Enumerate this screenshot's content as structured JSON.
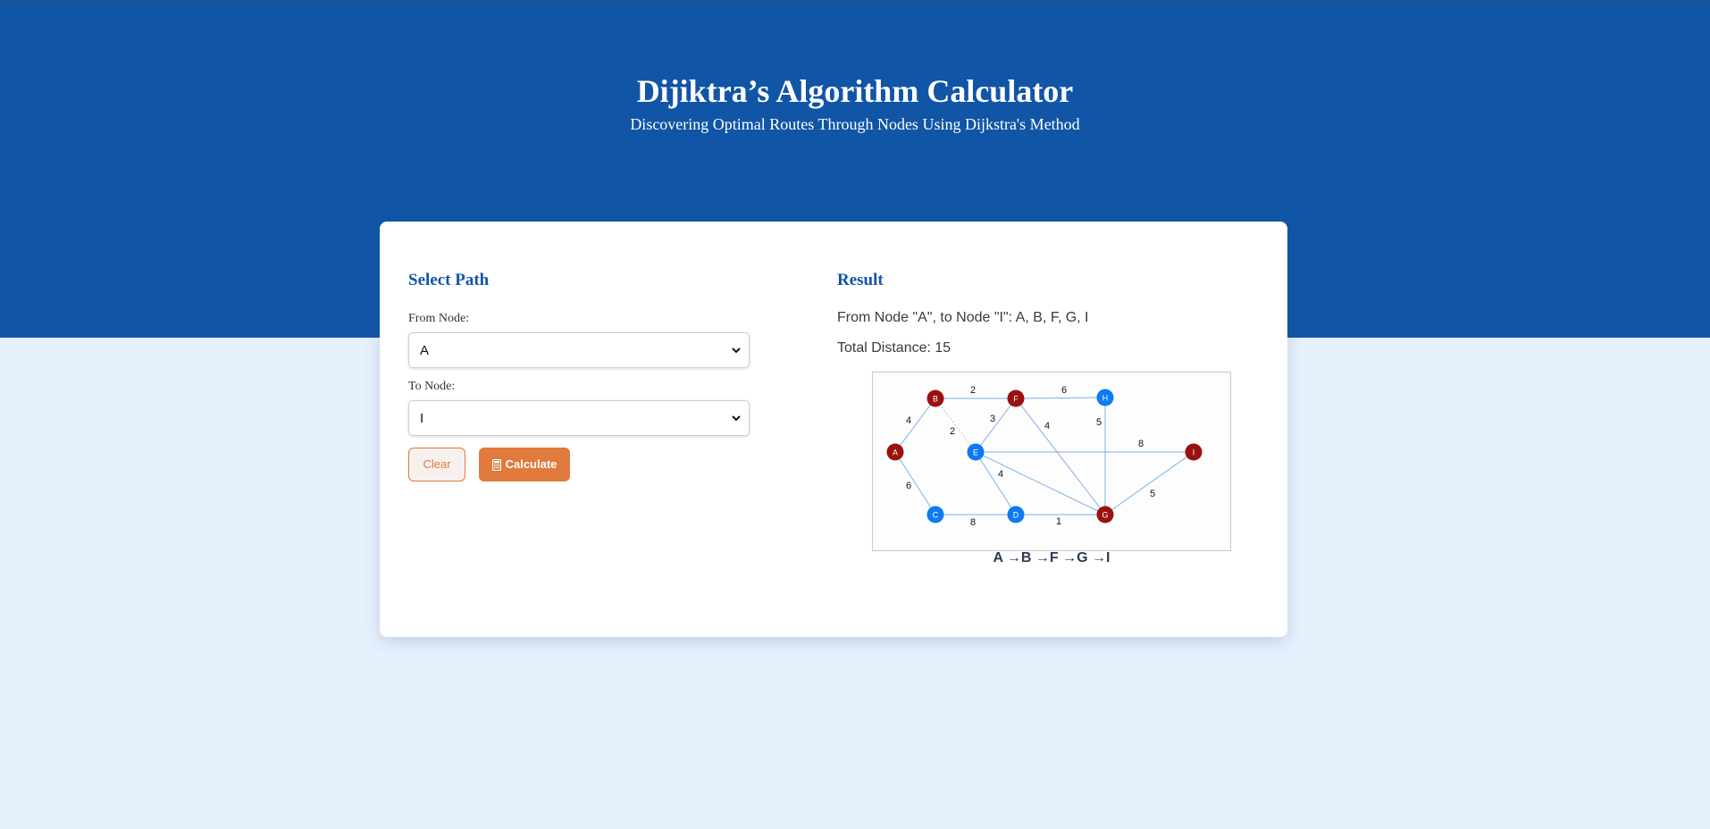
{
  "header": {
    "title": "Dijiktra’s Algorithm Calculator",
    "subtitle": "Discovering Optimal Routes Through Nodes Using Dijkstra's Method"
  },
  "select_path": {
    "title": "Select Path",
    "from_label": "From Node:",
    "from_value": "A",
    "to_label": "To Node:",
    "to_value": "I",
    "clear_label": "Clear",
    "calculate_label": "Calculate",
    "calculate_icon": "calculator-icon"
  },
  "result": {
    "title": "Result",
    "route_line": "From Node \"A\", to Node \"I\": A, B, F, G, I",
    "distance_line": "Total Distance: 15",
    "path_display": "A →B →F →G →I"
  },
  "graph": {
    "colors": {
      "on_path": "#9b1111",
      "off_path": "#0d7bf2",
      "edge": "#7ab1e6",
      "frame": "#c8c8c8"
    },
    "nodes": [
      {
        "id": "A",
        "on_path": true
      },
      {
        "id": "B",
        "on_path": true
      },
      {
        "id": "C",
        "on_path": false
      },
      {
        "id": "D",
        "on_path": false
      },
      {
        "id": "E",
        "on_path": false
      },
      {
        "id": "F",
        "on_path": true
      },
      {
        "id": "G",
        "on_path": true
      },
      {
        "id": "H",
        "on_path": false
      },
      {
        "id": "I",
        "on_path": true
      }
    ],
    "edges": [
      {
        "from": "A",
        "to": "B",
        "weight": "4"
      },
      {
        "from": "A",
        "to": "C",
        "weight": "6"
      },
      {
        "from": "B",
        "to": "F",
        "weight": "2"
      },
      {
        "from": "B",
        "to": "E",
        "weight": "2",
        "dashed": true
      },
      {
        "from": "C",
        "to": "D",
        "weight": "8"
      },
      {
        "from": "D",
        "to": "G",
        "weight": "1"
      },
      {
        "from": "E",
        "to": "F",
        "weight": "3"
      },
      {
        "from": "E",
        "to": "D",
        "weight": "4"
      },
      {
        "from": "E",
        "to": "I",
        "weight": "8"
      },
      {
        "from": "E",
        "to": "G",
        "weight": ""
      },
      {
        "from": "F",
        "to": "H",
        "weight": "6"
      },
      {
        "from": "F",
        "to": "G",
        "weight": "4"
      },
      {
        "from": "H",
        "to": "G",
        "weight": "5"
      },
      {
        "from": "G",
        "to": "I",
        "weight": "5"
      }
    ]
  }
}
